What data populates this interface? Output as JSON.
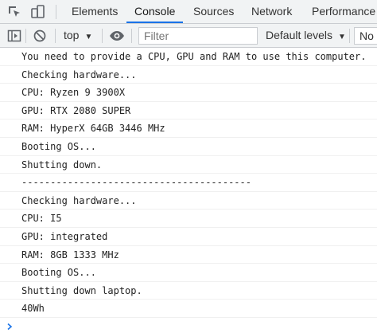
{
  "tabs": [
    {
      "label": "Elements"
    },
    {
      "label": "Console"
    },
    {
      "label": "Sources"
    },
    {
      "label": "Network"
    },
    {
      "label": "Performance"
    }
  ],
  "active_tab": "Console",
  "toolbar": {
    "context": "top",
    "filter_placeholder": "Filter",
    "levels": "Default levels",
    "partial_box": "No"
  },
  "icons": {
    "inspect": "inspect-element-icon",
    "device": "device-toolbar-icon",
    "sidebar": "show-sidebar-icon",
    "clear": "clear-console-icon",
    "eye": "live-expression-eye-icon",
    "prompt": "console-prompt-chevron-icon"
  },
  "colors": {
    "accent": "#1a73e8",
    "prompt": "#1a73e8",
    "toolbar_bg": "#f1f3f4"
  },
  "messages": [
    "You need to provide a CPU, GPU and RAM to use this computer.",
    "Checking hardware...",
    "CPU: Ryzen 9 3900X",
    "GPU: RTX 2080 SUPER",
    "RAM: HyperX 64GB 3446 MHz",
    "Booting OS...",
    "Shutting down.",
    "----------------------------------------",
    "Checking hardware...",
    "CPU: I5",
    "GPU: integrated",
    "RAM: 8GB 1333 MHz",
    "Booting OS...",
    "Shutting down laptop.",
    "40Wh"
  ]
}
